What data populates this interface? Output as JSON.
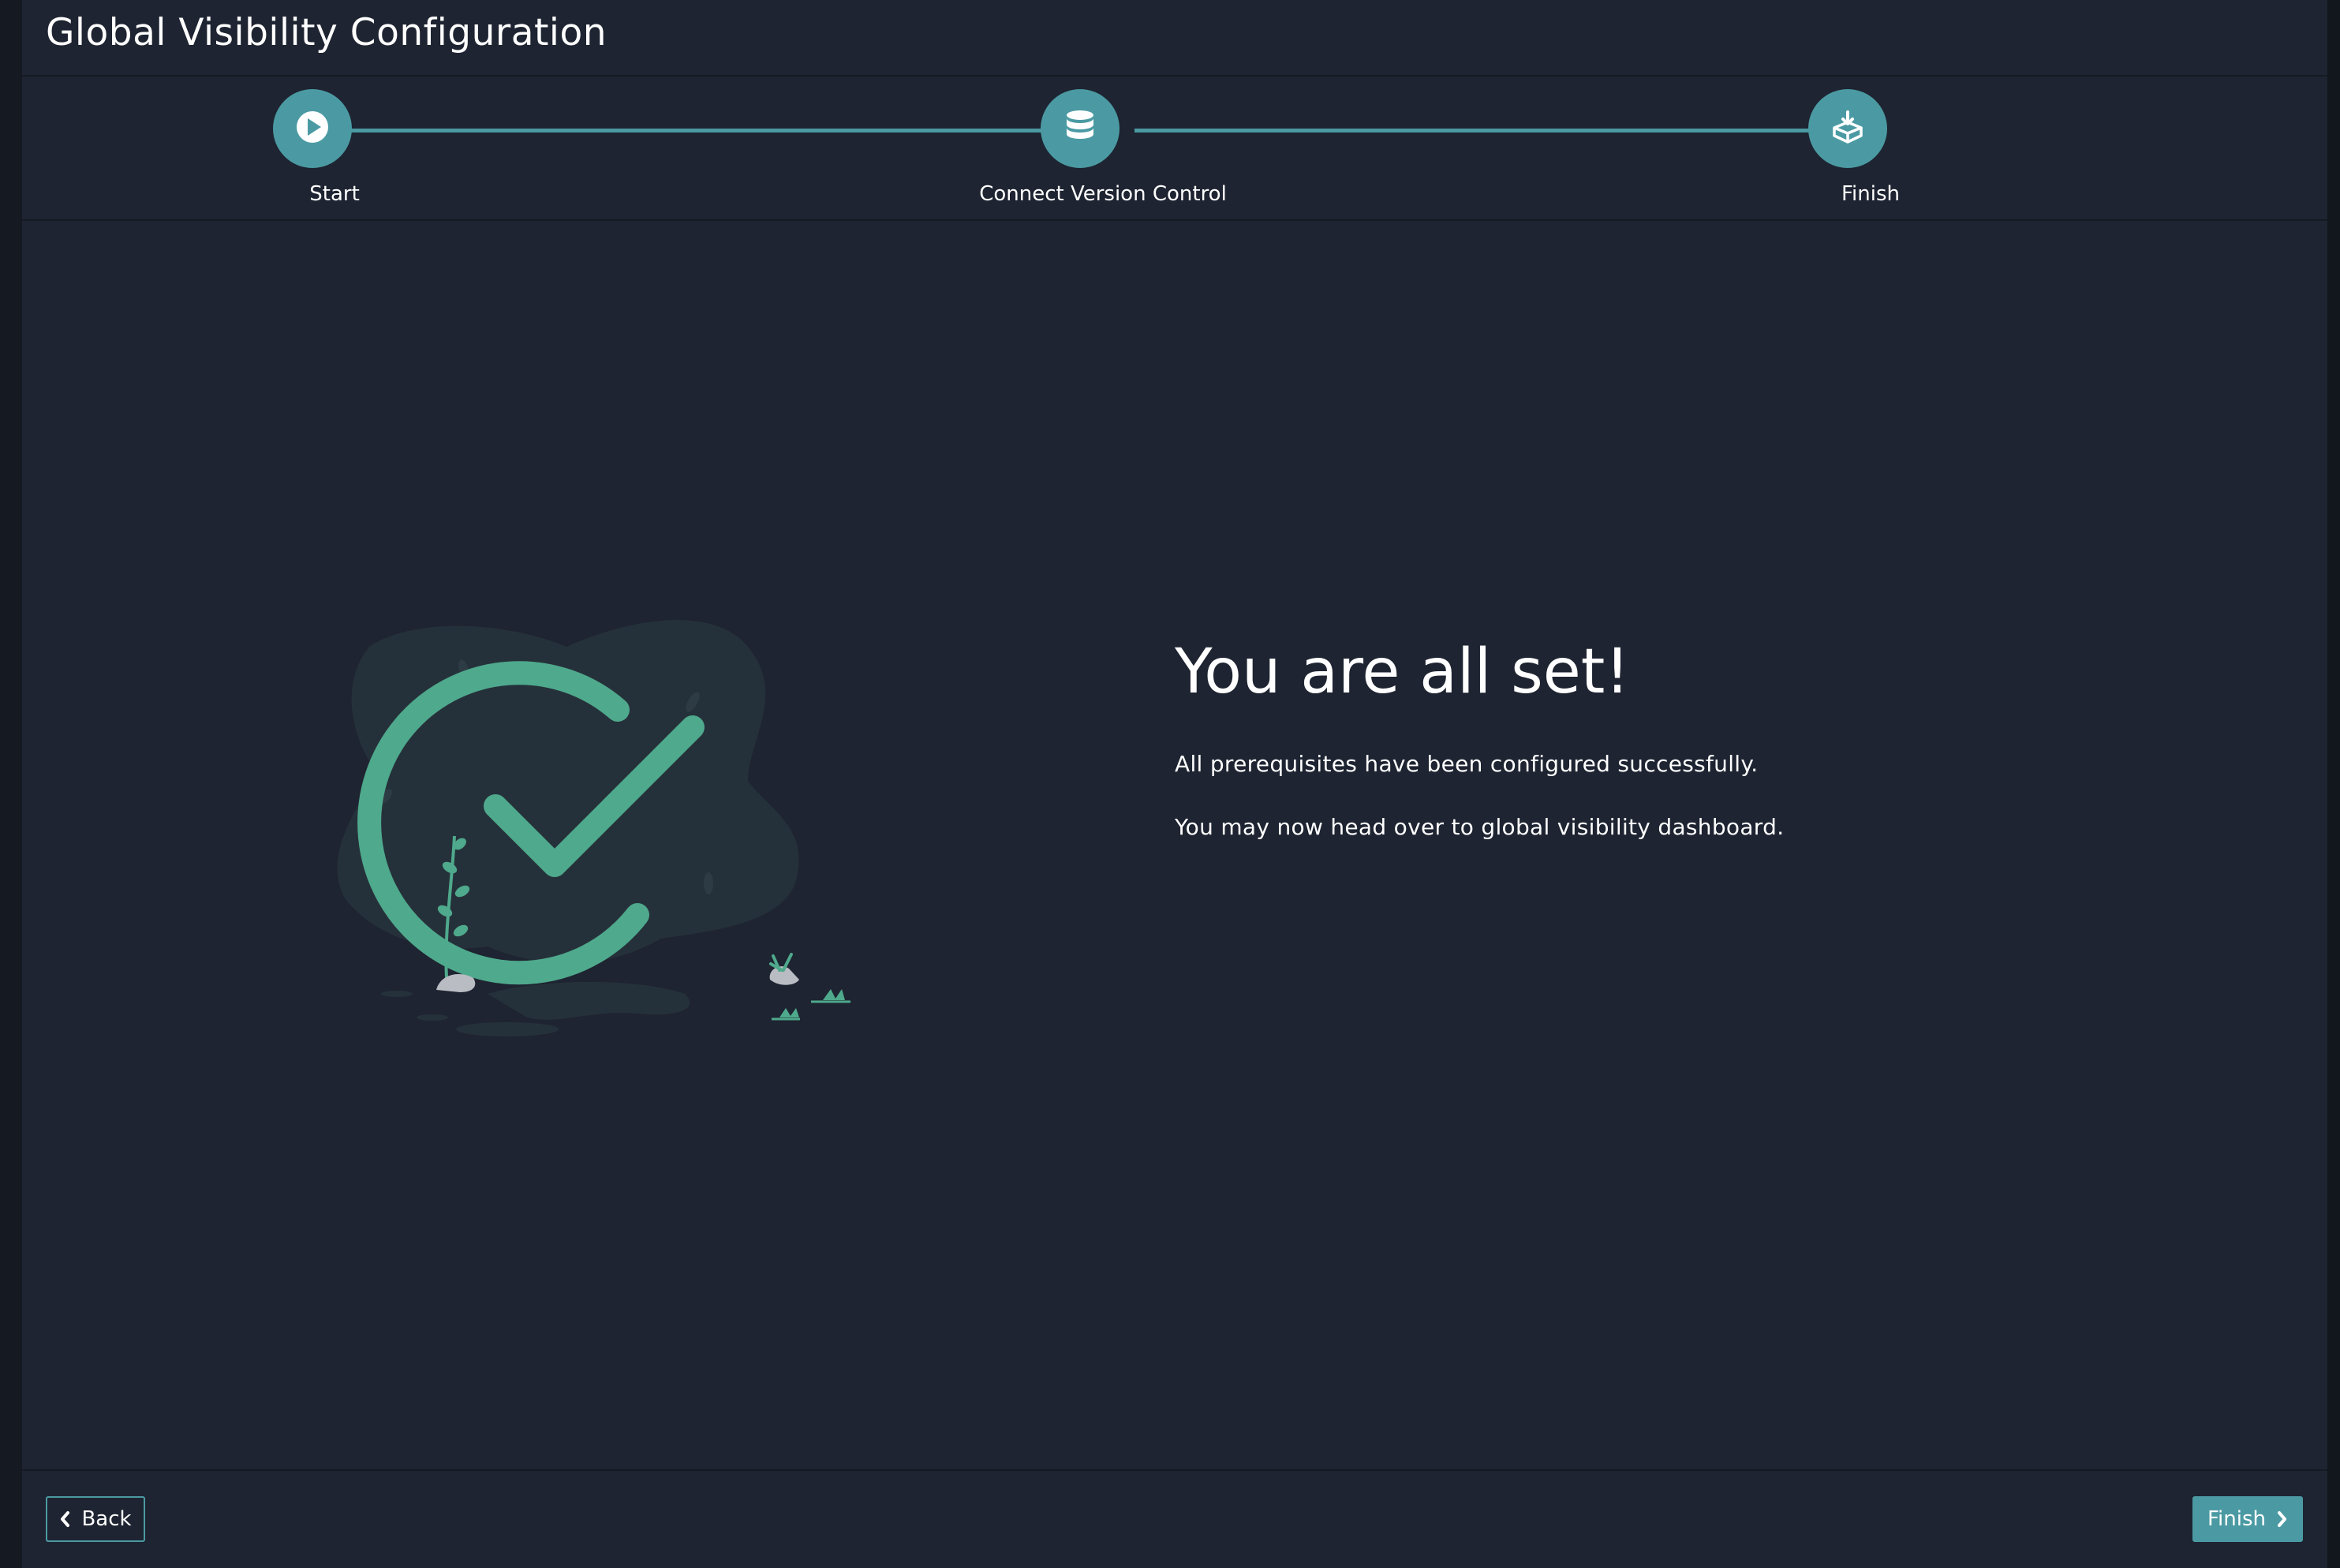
{
  "title": "Global Visibility Configuration",
  "colors": {
    "accent": "#4b9aa3",
    "success": "#4fa98c",
    "background": "#1e2431"
  },
  "stepper": {
    "steps": [
      {
        "label": "Start",
        "icon": "play-icon"
      },
      {
        "label": "Connect Version Control",
        "icon": "database-icon"
      },
      {
        "label": "Finish",
        "icon": "deploy-box-icon"
      }
    ]
  },
  "content": {
    "heading": "You are all set!",
    "line1": "All prerequisites have been configured successfully.",
    "line2": "You may now head over to global visibility dashboard.",
    "illustration": "success-checkmark-icon"
  },
  "footer": {
    "back_label": "Back",
    "finish_label": "Finish"
  }
}
